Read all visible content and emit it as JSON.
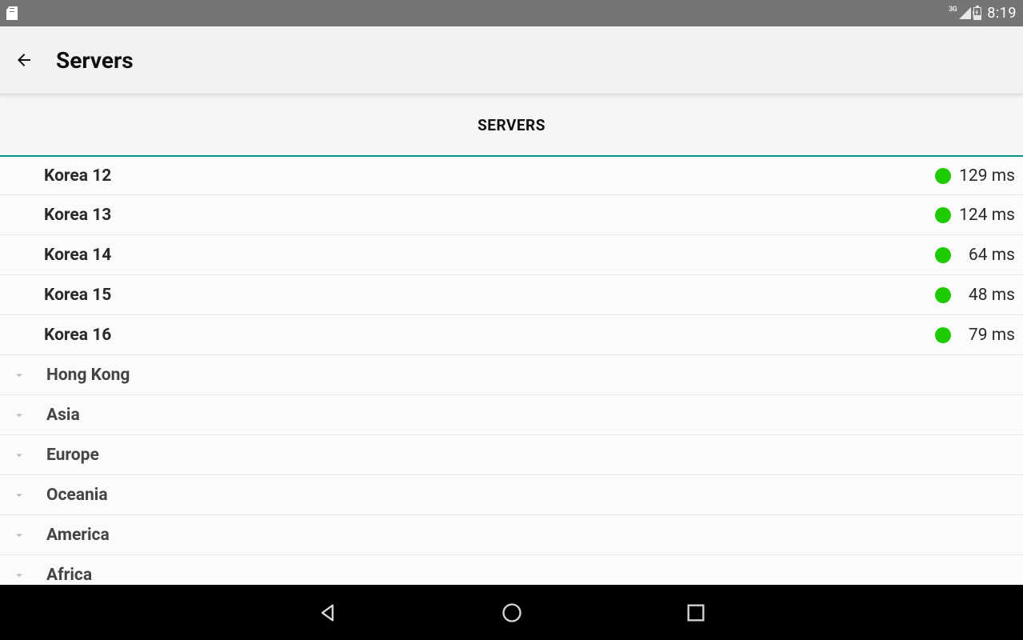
{
  "status_bar": {
    "network_label": "3G",
    "clock": "8:19"
  },
  "app_bar": {
    "title": "Servers"
  },
  "tab": {
    "label": "SERVERS"
  },
  "servers": [
    {
      "name": "Korea 12",
      "latency": "129 ms",
      "status_color": "#1ecb00"
    },
    {
      "name": "Korea 13",
      "latency": "124 ms",
      "status_color": "#1ecb00"
    },
    {
      "name": "Korea 14",
      "latency": "64 ms",
      "status_color": "#1ecb00"
    },
    {
      "name": "Korea 15",
      "latency": "48 ms",
      "status_color": "#1ecb00"
    },
    {
      "name": "Korea 16",
      "latency": "79 ms",
      "status_color": "#1ecb00"
    }
  ],
  "regions": [
    {
      "name": "Hong Kong"
    },
    {
      "name": "Asia"
    },
    {
      "name": "Europe"
    },
    {
      "name": "Oceania"
    },
    {
      "name": "America"
    },
    {
      "name": "Africa"
    }
  ],
  "colors": {
    "accent": "#009688",
    "status_good": "#1ecb00"
  }
}
